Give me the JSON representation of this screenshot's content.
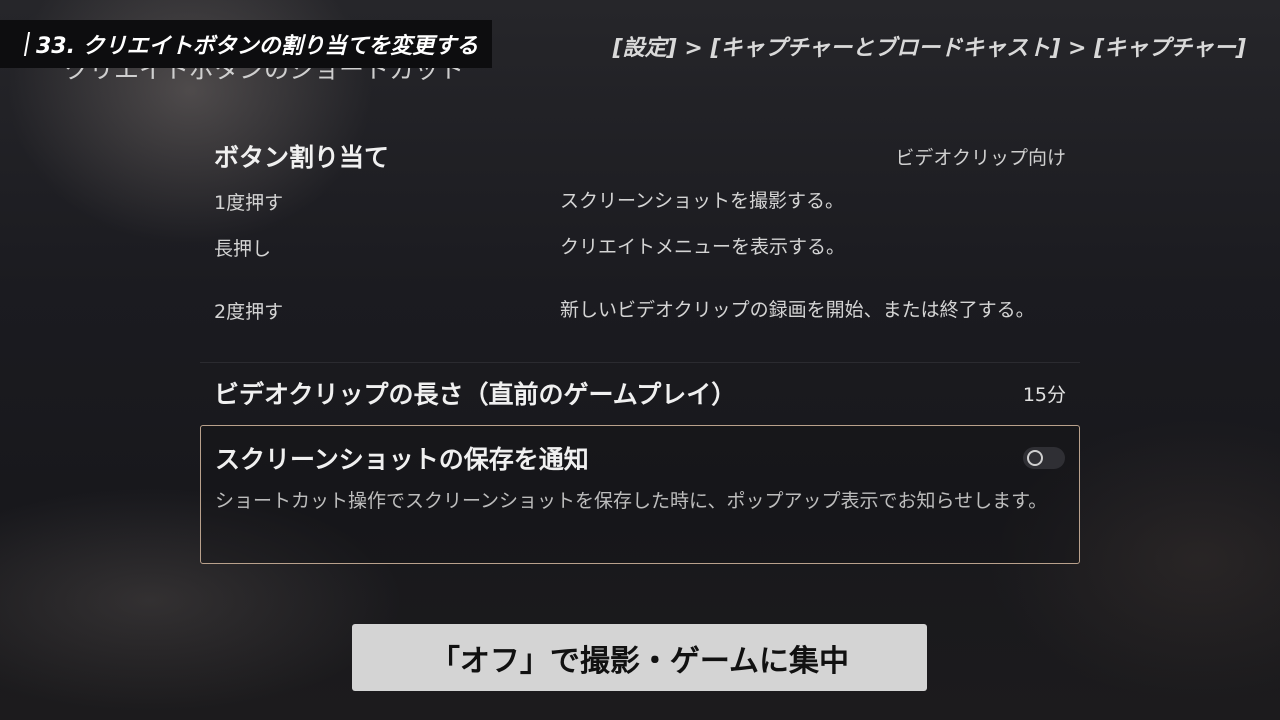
{
  "hint_banner": {
    "text": "33. クリエイトボタンの割り当てを変更する"
  },
  "breadcrumb": {
    "text": "[設定]  >  [キャプチャーとブロードキャスト]  >  [キャプチャー]"
  },
  "page_heading": "クリエイトボタンのショートカット",
  "button_assignment": {
    "title": "ボタン割り当て",
    "value": "ビデオクリップ向け",
    "rows": [
      {
        "action": "1度押す",
        "result": "スクリーンショットを撮影する。"
      },
      {
        "action": "長押し",
        "result": "クリエイトメニューを表示する。"
      },
      {
        "action": "2度押す",
        "result": "新しいビデオクリップの録画を開始、または終了する。"
      }
    ]
  },
  "video_clip_length": {
    "title": "ビデオクリップの長さ（直前のゲームプレイ）",
    "value": "15分"
  },
  "screenshot_notification": {
    "title": "スクリーンショットの保存を通知",
    "description": "ショートカット操作でスクリーンショットを保存した時に、ポップアップ表示でお知らせします。",
    "toggle_state": "off"
  },
  "caption": "「オフ」で撮影・ゲームに集中",
  "colors": {
    "card_border": "#b9a18c",
    "caption_bg": "#d4d4d4"
  }
}
